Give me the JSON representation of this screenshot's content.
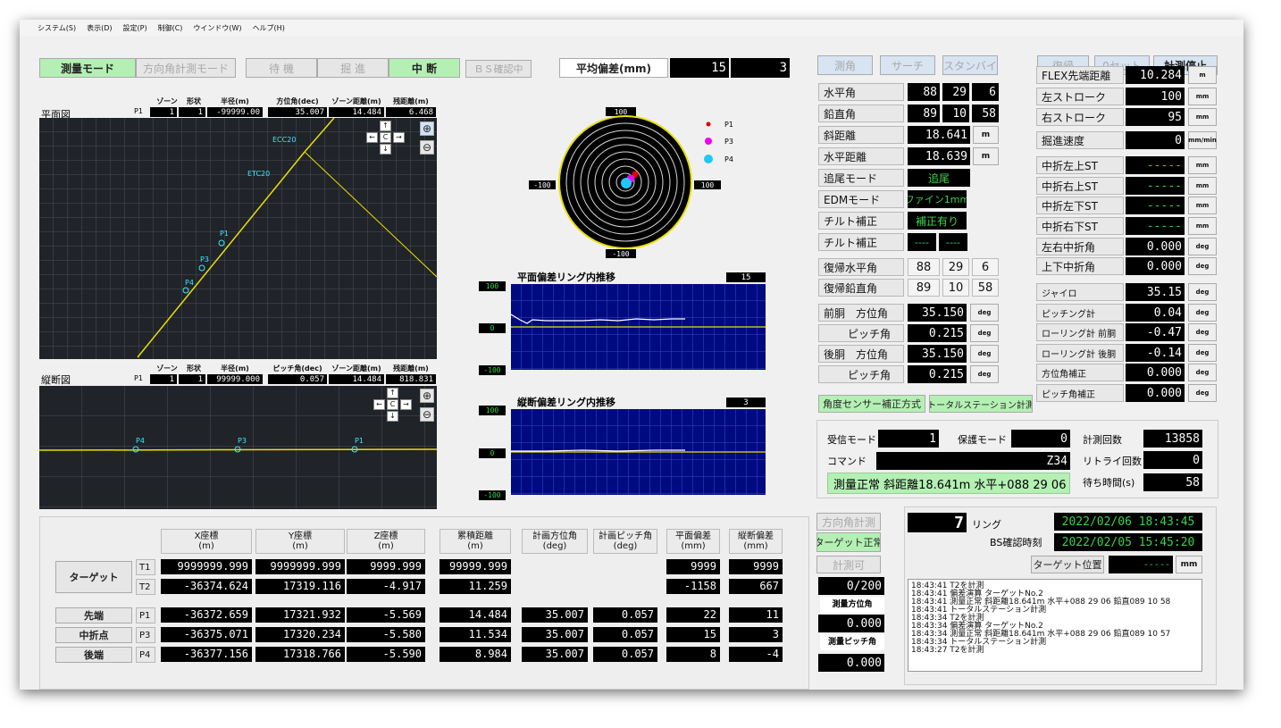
{
  "menu": [
    "システム(S)",
    "表示(D)",
    "設定(P)",
    "制御(C)",
    "ウインドウ(W)",
    "ヘルプ(H)"
  ],
  "top": {
    "mode1": "測量モード",
    "mode2": "方向角計測モード",
    "wait": "待 機",
    "advance": "掘 進",
    "stop": "中 断",
    "bs": "ＢＳ確認中",
    "avg_label": "平均偏差(mm)",
    "avg_h": "15",
    "avg_v": "3"
  },
  "plan": {
    "title": "平面図",
    "hz": "ゾーン",
    "hs": "形状",
    "hr": "半径(m)",
    "ha": "方位角(dec)",
    "hzd": "ゾーン距離(m)",
    "hrem": "残距離(m)",
    "p": "P1",
    "zone": "1",
    "shape": "1",
    "radius": "-99999.00",
    "azimuth": "35.007",
    "zdist": "14.484",
    "rem": "6.468",
    "labels": [
      "ECC20",
      "ETC20",
      "P1",
      "P3",
      "P4"
    ]
  },
  "vert": {
    "title": "縦断図",
    "hz": "ゾーン",
    "hs": "形状",
    "hr": "半径(m)",
    "ha": "ピッチ角(dec)",
    "hzd": "ゾーン距離(m)",
    "hrem": "残距離(m)",
    "p": "P1",
    "zone": "1",
    "shape": "1",
    "radius": "99999.000",
    "pitch": "0.057",
    "zdist": "14.484",
    "rem": "818.831",
    "labels": [
      "P4",
      "P3",
      "P1"
    ]
  },
  "nav": {
    "up": "↑",
    "down": "↓",
    "left": "←",
    "right": "→",
    "center": "C",
    "zin": "⊕",
    "zout": "⊖"
  },
  "target": {
    "top": "100",
    "bottom": "-100",
    "left": "-100",
    "right": "100",
    "legend": [
      "P1",
      "P3",
      "P4"
    ],
    "colors": [
      "#e00000",
      "#f000f0",
      "#20c8f8"
    ]
  },
  "trend1": {
    "title": "平面偏差リング内推移",
    "value": "15",
    "ymax": "100",
    "ymid": "0",
    "ymin": "-100"
  },
  "trend2": {
    "title": "縦断偏差リング内推移",
    "value": "3",
    "ymax": "100",
    "ymid": "0",
    "ymin": "-100"
  },
  "ctrl": {
    "b1": "測角",
    "b2": "サーチ",
    "b3": "スタンバイ",
    "b4": "復帰",
    "b5": "0セット",
    "b6": "計測停止"
  },
  "ts": {
    "hang": {
      "label": "水平角",
      "d": "88",
      "m": "29",
      "s": "6"
    },
    "vang": {
      "label": "鉛直角",
      "d": "89",
      "m": "10",
      "s": "58"
    },
    "slope": {
      "label": "斜距離",
      "v": "18.641",
      "u": "m"
    },
    "hdist": {
      "label": "水平距離",
      "v": "18.639",
      "u": "m"
    },
    "track": {
      "label": "追尾モード",
      "v": "追尾"
    },
    "edm": {
      "label": "EDMモード",
      "v": "ファイン1mm"
    },
    "tilt": {
      "label": "チルト補正",
      "v": "補正有り"
    },
    "tilt2": {
      "label": "チルト補正",
      "a": "----",
      "b": "----"
    },
    "rh": {
      "label": "復帰水平角",
      "d": "88",
      "m": "29",
      "s": "6"
    },
    "rv": {
      "label": "復帰鉛直角",
      "d": "89",
      "m": "10",
      "s": "58"
    },
    "fa": {
      "label": "前胴　方位角",
      "v": "35.150",
      "u": "deg"
    },
    "fp": {
      "label": "ピッチ角",
      "v": "0.215",
      "u": "deg"
    },
    "ra": {
      "label": "後胴　方位角",
      "v": "35.150",
      "u": "deg"
    },
    "rp": {
      "label": "ピッチ角",
      "v": "0.215",
      "u": "deg"
    }
  },
  "flex": [
    {
      "label": "FLEX先端距離",
      "v": "10.284",
      "u": "m"
    },
    {
      "label": "左ストローク",
      "v": "100",
      "u": "mm"
    },
    {
      "label": "右ストローク",
      "v": "95",
      "u": "mm"
    },
    {
      "label": "掘進速度",
      "v": "0",
      "u": "mm/min"
    },
    {
      "label": "中折左上ST",
      "v": "-----",
      "u": "mm"
    },
    {
      "label": "中折右上ST",
      "v": "-----",
      "u": "mm"
    },
    {
      "label": "中折左下ST",
      "v": "-----",
      "u": "mm"
    },
    {
      "label": "中折右下ST",
      "v": "-----",
      "u": "mm"
    },
    {
      "label": "左右中折角",
      "v": "0.000",
      "u": "deg"
    },
    {
      "label": "上下中折角",
      "v": "0.000",
      "u": "deg"
    },
    {
      "label": "ジャイロ",
      "v": "35.15",
      "u": "deg"
    },
    {
      "label": "ピッチング計",
      "v": "0.04",
      "u": "deg"
    },
    {
      "label": "ローリング計 前胴",
      "v": "-0.47",
      "u": "deg"
    },
    {
      "label": "ローリング計 後胴",
      "v": "-0.14",
      "u": "deg"
    },
    {
      "label": "方位角補正",
      "v": "0.000",
      "u": "deg"
    },
    {
      "label": "ピッチ角補正",
      "v": "0.000",
      "u": "deg"
    }
  ],
  "method": {
    "a": "角度センサー補正方式",
    "b": "トータルステーション計測"
  },
  "comm": {
    "recv_label": "受信モード",
    "recv": "1",
    "keep_label": "保護モード",
    "keep": "0",
    "cmd_label": "コマンド",
    "cmd": "Z34",
    "status": "測量正常 斜距離18.641m 水平+088 29 06",
    "count_label": "計測回数",
    "count": "13858",
    "retry_label": "リトライ回数",
    "retry": "0",
    "wait_label": "待ち時間(s)",
    "wait": "58"
  },
  "table": {
    "headers": [
      "X座標\n(m)",
      "Y座標\n(m)",
      "Z座標\n(m)",
      "累積距離\n(m)",
      "計画方位角\n(deg)",
      "計画ピッチ角\n(deg)",
      "平面偏差\n(mm)",
      "縦断偏差\n(mm)"
    ],
    "target_label": "ターゲット",
    "t1": {
      "id": "T1",
      "x": "9999999.999",
      "y": "9999999.999",
      "z": "9999.999",
      "d": "99999.999",
      "h": "9999",
      "v": "9999"
    },
    "t2": {
      "id": "T2",
      "x": "-36374.624",
      "y": "17319.116",
      "z": "-4.917",
      "d": "11.259",
      "h": "-1158",
      "v": "667"
    },
    "rows": [
      {
        "name": "先端",
        "id": "P1",
        "x": "-36372.659",
        "y": "17321.932",
        "z": "-5.569",
        "d": "14.484",
        "a": "35.007",
        "p": "0.057",
        "h": "22",
        "v": "11"
      },
      {
        "name": "中折点",
        "id": "P3",
        "x": "-36375.071",
        "y": "17320.234",
        "z": "-5.580",
        "d": "11.534",
        "a": "35.007",
        "p": "0.057",
        "h": "15",
        "v": "3"
      },
      {
        "name": "後端",
        "id": "P4",
        "x": "-36377.156",
        "y": "17318.766",
        "z": "-5.590",
        "d": "8.984",
        "a": "35.007",
        "p": "0.057",
        "h": "8",
        "v": "-4"
      }
    ]
  },
  "side": {
    "b1": "方向角計測",
    "b2": "ターゲット正常",
    "b3": "計測可",
    "count": "0/200",
    "azl": "測量方位角",
    "az": "0.000",
    "pl": "測量ピッチ角",
    "p": "0.000"
  },
  "ring": {
    "n": "7",
    "label": "リング",
    "dt1": "2022/02/06 18:43:45",
    "bs_label": "BS確認時刻",
    "dt2": "2022/02/05 15:45:20",
    "tp_label": "ターゲット位置",
    "tp": "-----",
    "tp_u": "mm"
  },
  "log": [
    "18:43:41  T2を計測",
    "18:43:41  偏差演算 ターゲットNo.2",
    "18:43:41  測量正常 斜距離18.641m 水平+088 29 06 鉛直089 10 58",
    "18:43:41  トータルステーション計測",
    "18:43:34  T2を計測",
    "18:43:34  偏差演算 ターゲットNo.2",
    "18:43:34  測量正常 斜距離18.641m 水平+088 29 06 鉛直089 10 57",
    "18:43:34  トータルステーション計測",
    "18:43:27  T2を計測"
  ]
}
